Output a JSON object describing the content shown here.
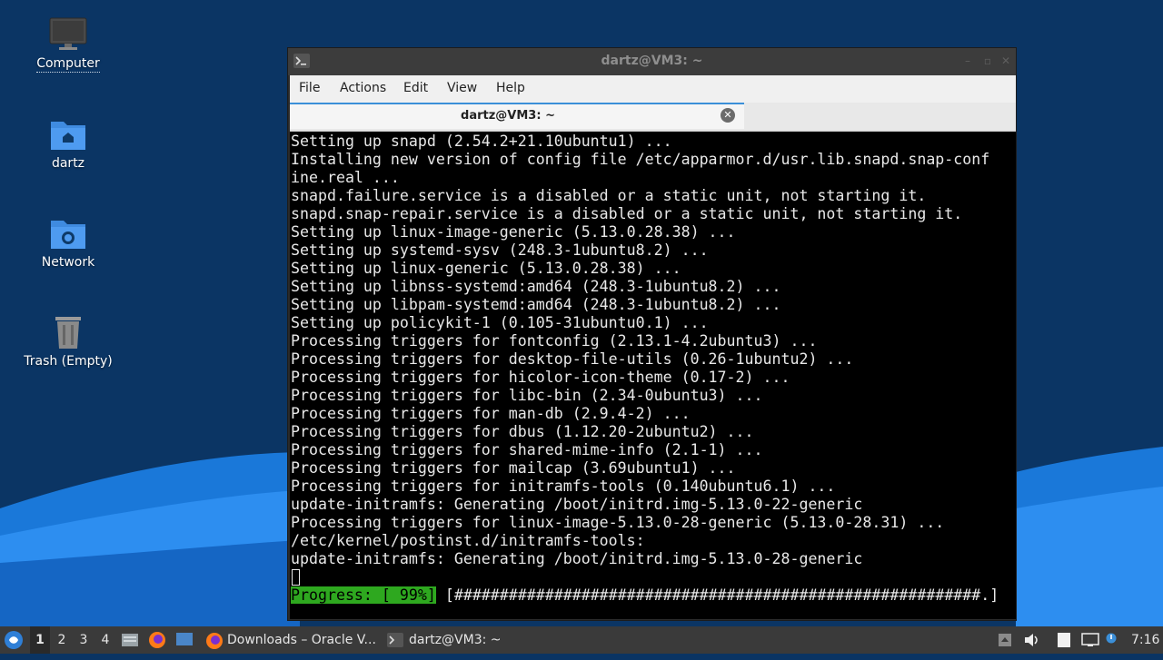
{
  "desktop": {
    "icons": [
      {
        "label": "Computer"
      },
      {
        "label": "dartz"
      },
      {
        "label": "Network"
      },
      {
        "label": "Trash (Empty)"
      }
    ]
  },
  "window": {
    "title": "dartz@VM3: ~",
    "menu": [
      "File",
      "Actions",
      "Edit",
      "View",
      "Help"
    ],
    "tab_label": "dartz@VM3: ~"
  },
  "terminal": {
    "lines": [
      "Setting up snapd (2.54.2+21.10ubuntu1) ...",
      "Installing new version of config file /etc/apparmor.d/usr.lib.snapd.snap-conf",
      "ine.real ...",
      "snapd.failure.service is a disabled or a static unit, not starting it.",
      "snapd.snap-repair.service is a disabled or a static unit, not starting it.",
      "Setting up linux-image-generic (5.13.0.28.38) ...",
      "Setting up systemd-sysv (248.3-1ubuntu8.2) ...",
      "Setting up linux-generic (5.13.0.28.38) ...",
      "Setting up libnss-systemd:amd64 (248.3-1ubuntu8.2) ...",
      "Setting up libpam-systemd:amd64 (248.3-1ubuntu8.2) ...",
      "Setting up policykit-1 (0.105-31ubuntu0.1) ...",
      "Processing triggers for fontconfig (2.13.1-4.2ubuntu3) ...",
      "Processing triggers for desktop-file-utils (0.26-1ubuntu2) ...",
      "Processing triggers for hicolor-icon-theme (0.17-2) ...",
      "Processing triggers for libc-bin (2.34-0ubuntu3) ...",
      "Processing triggers for man-db (2.9.4-2) ...",
      "Processing triggers for dbus (1.12.20-2ubuntu2) ...",
      "Processing triggers for shared-mime-info (2.1-1) ...",
      "Processing triggers for mailcap (3.69ubuntu1) ...",
      "Processing triggers for initramfs-tools (0.140ubuntu6.1) ...",
      "update-initramfs: Generating /boot/initrd.img-5.13.0-22-generic",
      "Processing triggers for linux-image-5.13.0-28-generic (5.13.0-28.31) ...",
      "/etc/kernel/postinst.d/initramfs-tools:",
      "update-initramfs: Generating /boot/initrd.img-5.13.0-28-generic"
    ],
    "progress_label": "Progress: [ 99%]",
    "progress_bar": " [##########################################################.]"
  },
  "taskbar": {
    "workspaces": [
      "1",
      "2",
      "3",
      "4"
    ],
    "active_workspace": "1",
    "tasks": [
      {
        "label": "Downloads – Oracle V...",
        "icon": "firefox-icon"
      },
      {
        "label": "dartz@VM3: ~",
        "icon": "terminal-icon"
      }
    ],
    "clock": "7:16"
  },
  "colors": {
    "desktop_bg": "#0a3463",
    "terminal_bg": "#000000",
    "progress_bg": "#2ea81f",
    "taskbar_bg": "#3a3a3a"
  }
}
